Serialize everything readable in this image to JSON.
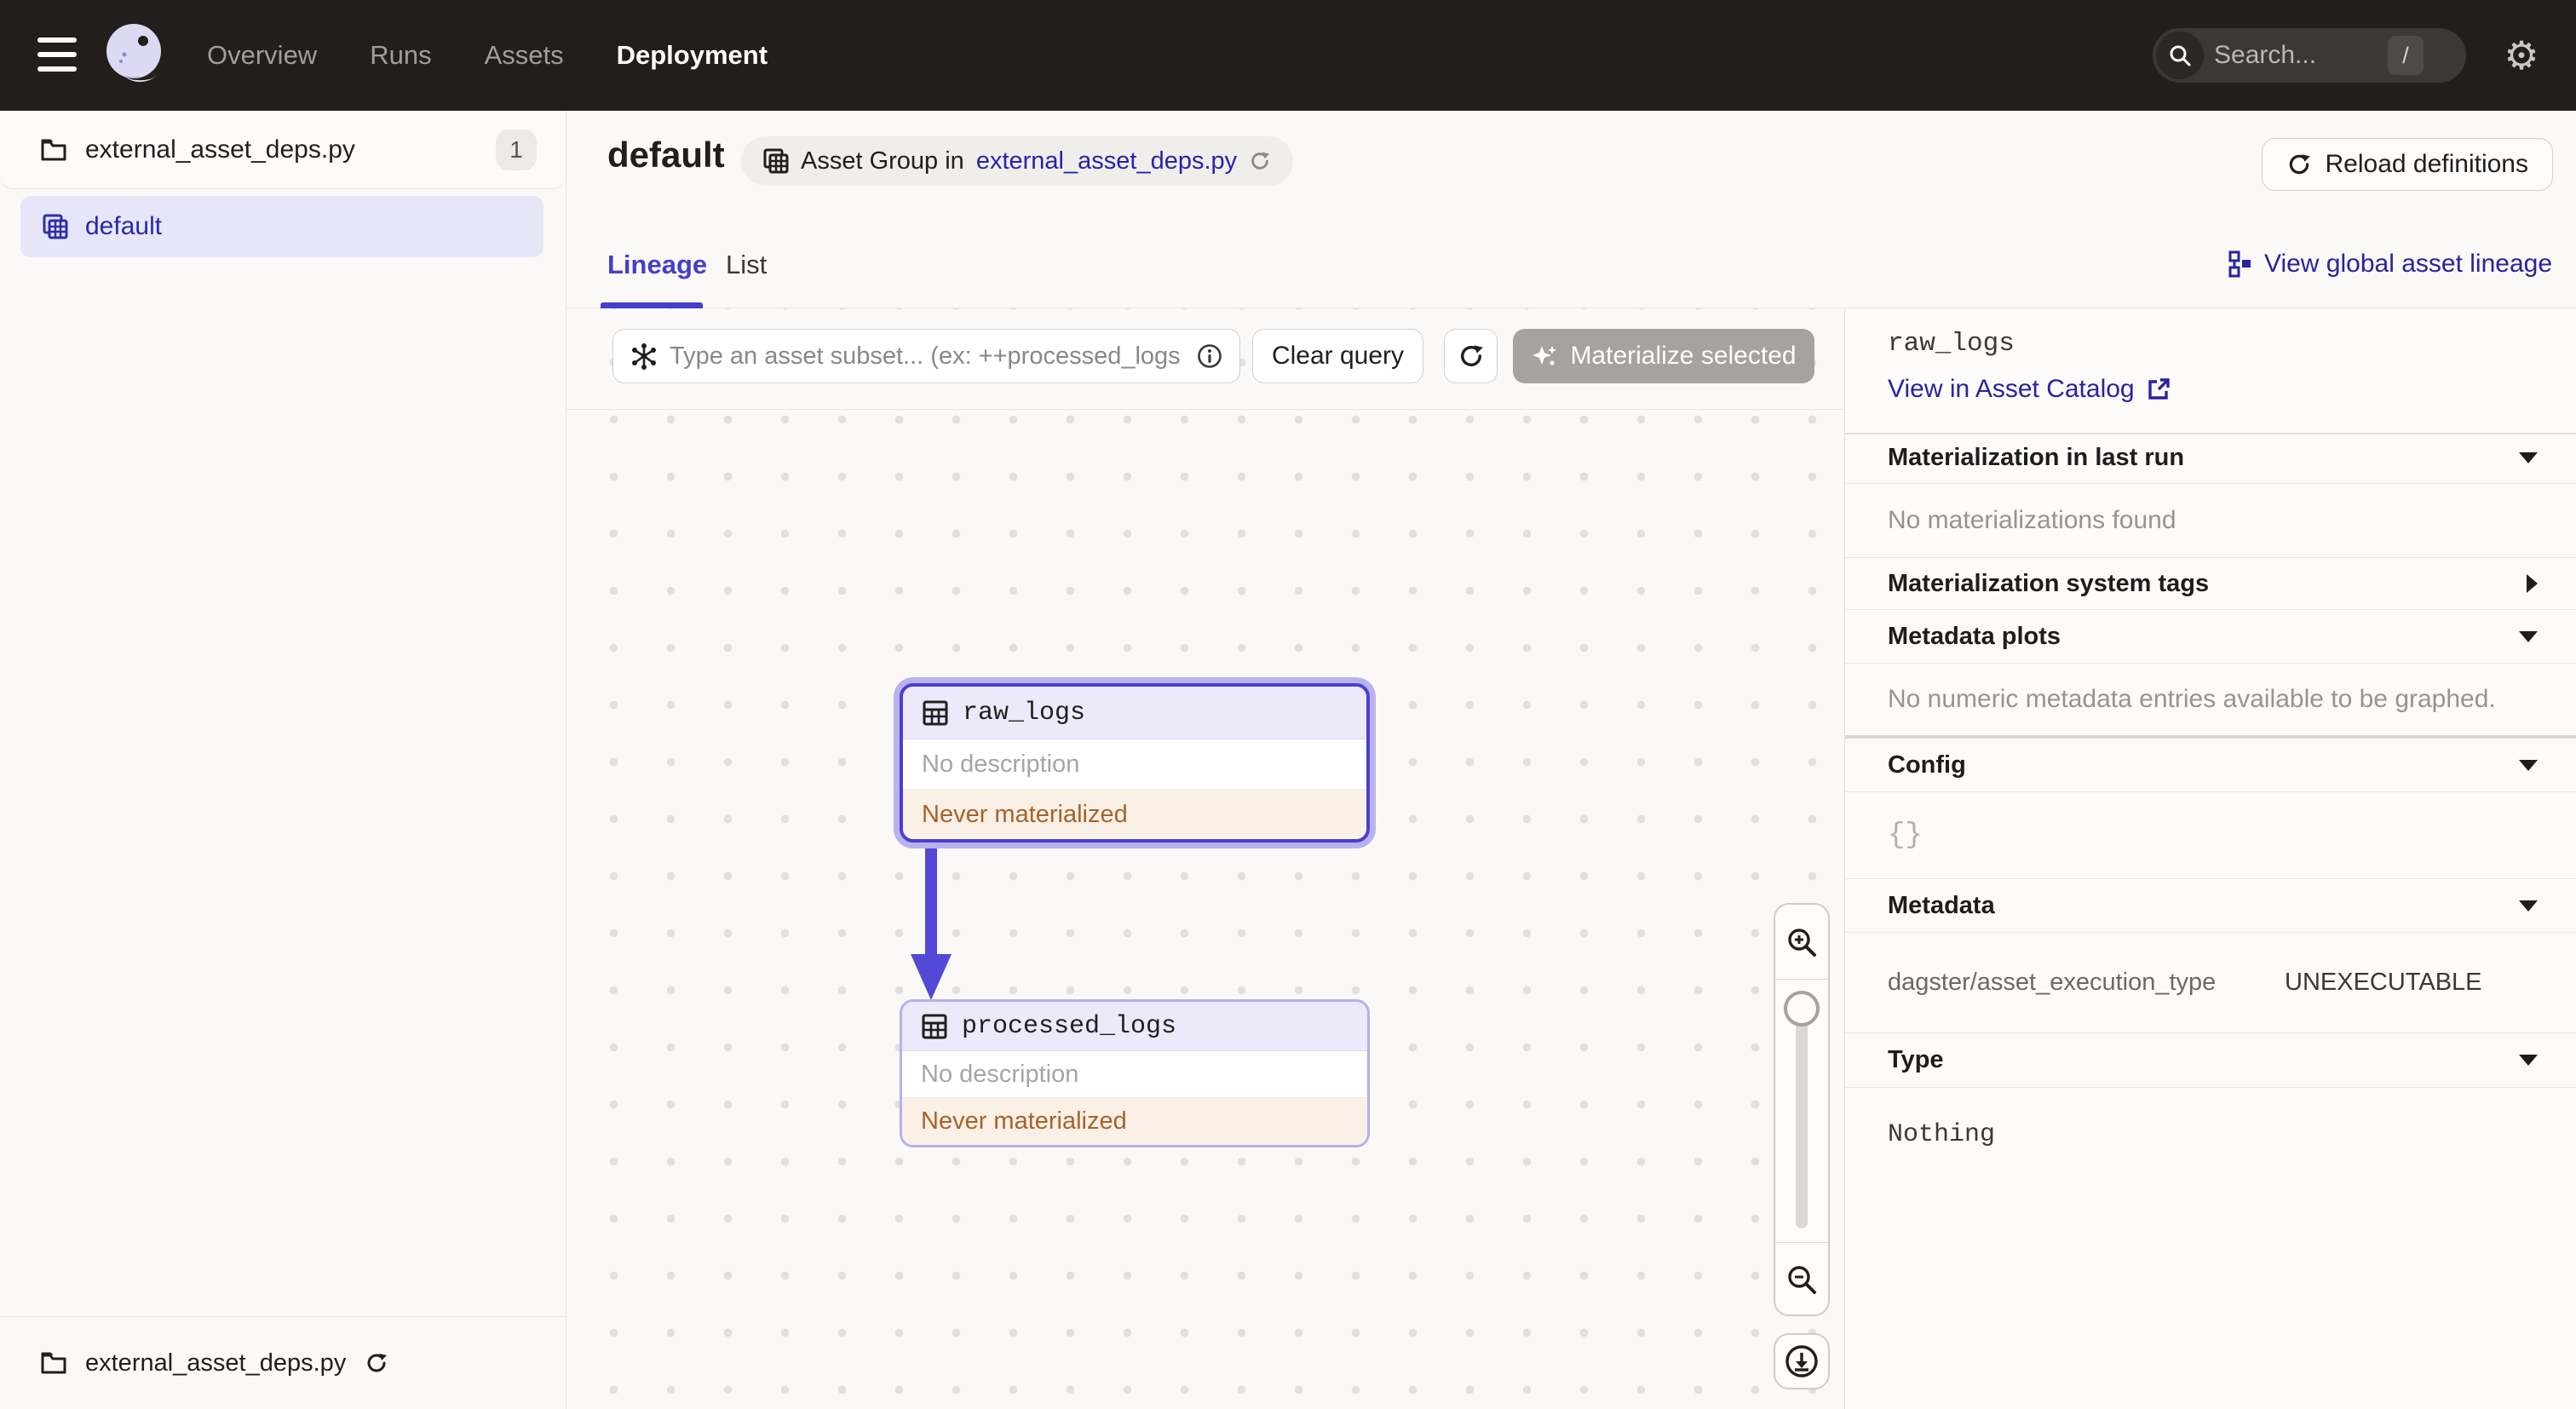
{
  "topbar": {
    "nav": [
      {
        "label": "Overview"
      },
      {
        "label": "Runs"
      },
      {
        "label": "Assets"
      },
      {
        "label": "Deployment"
      }
    ],
    "search_placeholder": "Search...",
    "search_shortcut": "/",
    "gear_icon": "gear-icon"
  },
  "sidebar": {
    "repo_file": "external_asset_deps.py",
    "repo_badge": "1",
    "group_item": "default",
    "footer_file": "external_asset_deps.py"
  },
  "header": {
    "title": "default",
    "pill_text": "Asset Group in",
    "pill_link": "external_asset_deps.py",
    "reload_label": "Reload definitions"
  },
  "tabs": {
    "lineage": "Lineage",
    "list": "List",
    "global_link": "View global asset lineage"
  },
  "toolbar": {
    "query_placeholder": "Type an asset subset... (ex: ++processed_logs",
    "clear_label": "Clear query",
    "materialize_label": "Materialize selected"
  },
  "graph": {
    "nodes": [
      {
        "name": "raw_logs",
        "description": "No description",
        "status": "Never materialized"
      },
      {
        "name": "processed_logs",
        "description": "No description",
        "status": "Never materialized"
      }
    ]
  },
  "panel": {
    "title": "raw_logs",
    "catalog_link": "View in Asset Catalog",
    "sections": [
      {
        "title": "Materialization in last run",
        "body": "No materializations found"
      },
      {
        "title": "Materialization system tags"
      },
      {
        "title": "Metadata plots",
        "body": "No numeric metadata entries available to be graphed."
      },
      {
        "title": "Config",
        "body": "{}"
      },
      {
        "title": "Metadata",
        "meta_label": "dagster/asset_execution_type",
        "meta_value": "UNEXECUTABLE"
      },
      {
        "title": "Type",
        "body": "Nothing"
      }
    ]
  },
  "colors": {
    "accent_indigo": "#4A3FD0",
    "link_navy": "#28239E",
    "warning_text": "#A8622B",
    "topbar_bg": "#211E1C"
  }
}
